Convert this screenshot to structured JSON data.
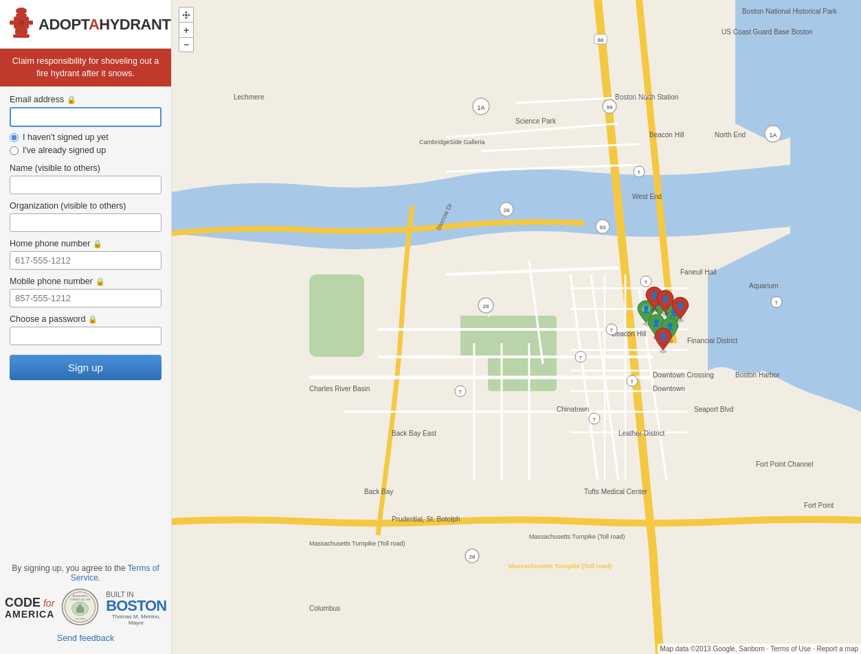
{
  "logo": {
    "alt": "Adopt-a-Hydrant",
    "text_adopt": "ADOPT",
    "text_a": "A",
    "text_hydrant": "HYDRANT"
  },
  "tagline": "Claim responsibility for shoveling out a fire hydrant after it snows.",
  "form": {
    "email_label": "Email address",
    "email_placeholder": "",
    "radio_new": "I haven't signed up yet",
    "radio_existing": "I've already signed up",
    "name_label": "Name (visible to others)",
    "name_placeholder": "",
    "org_label": "Organization (visible to others)",
    "org_placeholder": "",
    "phone_label": "Home phone number",
    "phone_placeholder": "617-555-1212",
    "mobile_label": "Mobile phone number",
    "mobile_placeholder": "857-555-1212",
    "password_label": "Choose a password",
    "password_placeholder": "",
    "signup_button": "Sign up"
  },
  "footer": {
    "tos_text": "By signing up, you agree to the",
    "tos_link": "Terms of Service.",
    "cfa_code": "CODE",
    "cfa_for": "for",
    "cfa_america": "AMERICA",
    "built_in": "Built in",
    "boston": "BOSTON",
    "mayor": "Thomas M. Menino, Mayor",
    "feedback_link": "Send feedback"
  },
  "map": {
    "attribution": "Map data ©2013 Google, Sanborn · Terms of Use · Report a map"
  },
  "icons": {
    "lock": "🔒",
    "hydrant": "🚒",
    "zoom_in": "+",
    "zoom_out": "−",
    "person_icon": "👤"
  }
}
